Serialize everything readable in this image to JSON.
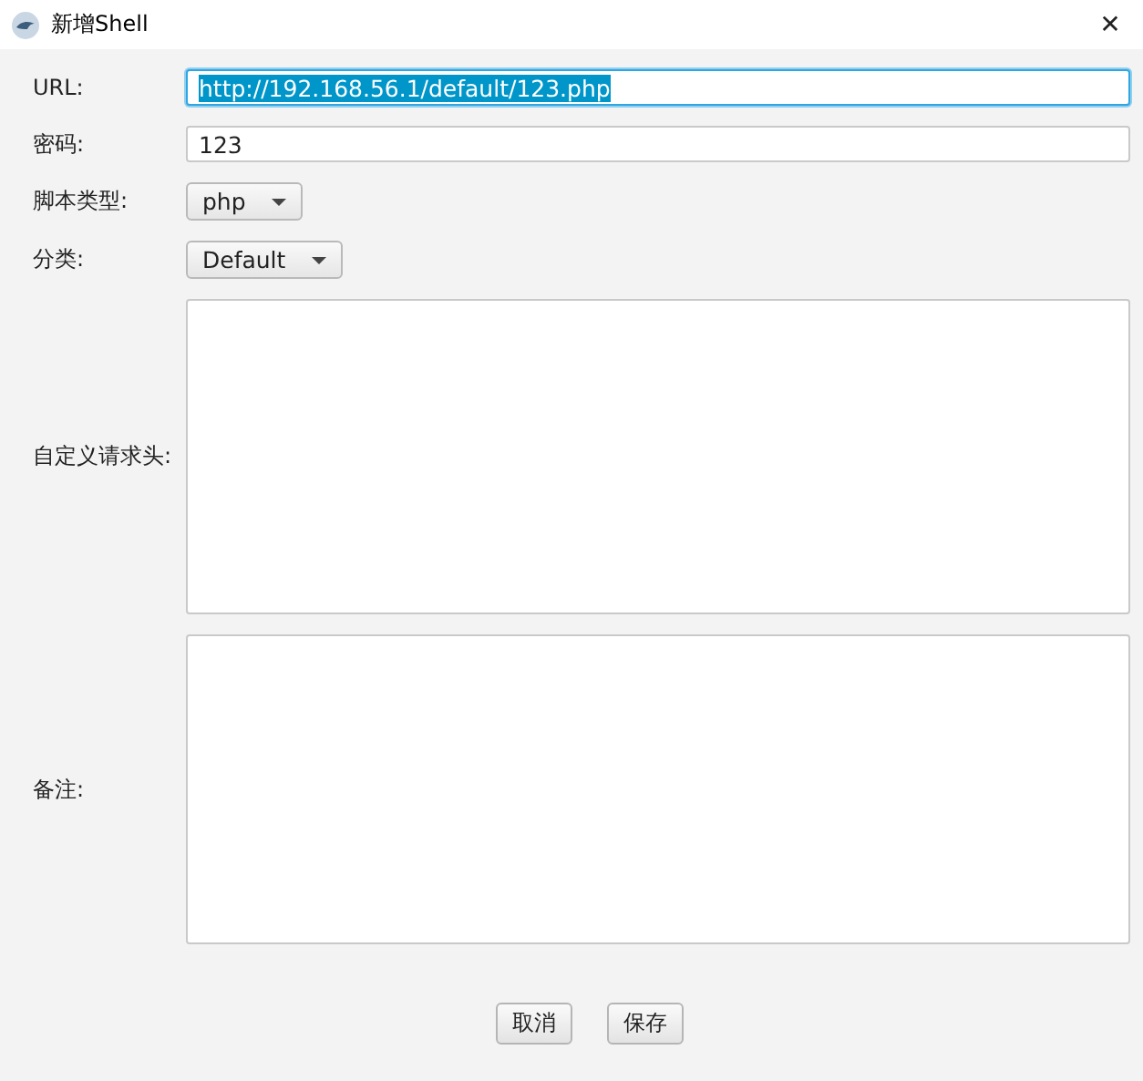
{
  "window": {
    "title": "新增Shell",
    "close": "✕"
  },
  "fields": [
    {
      "kind": "text",
      "label": "URL:",
      "value": "http://192.168.56.1/default/123.php",
      "focused": true,
      "text_selected": true
    },
    {
      "kind": "text",
      "label": "密码:",
      "value": "123",
      "focused": false,
      "text_selected": false
    },
    {
      "kind": "select",
      "label": "脚本类型:",
      "value": "php"
    },
    {
      "kind": "select",
      "label": "分类:",
      "value": "Default"
    },
    {
      "kind": "area",
      "label": "自定义请求头:"
    },
    {
      "kind": "area",
      "label": "备注:"
    }
  ],
  "buttons": [
    "取消",
    "保存"
  ]
}
